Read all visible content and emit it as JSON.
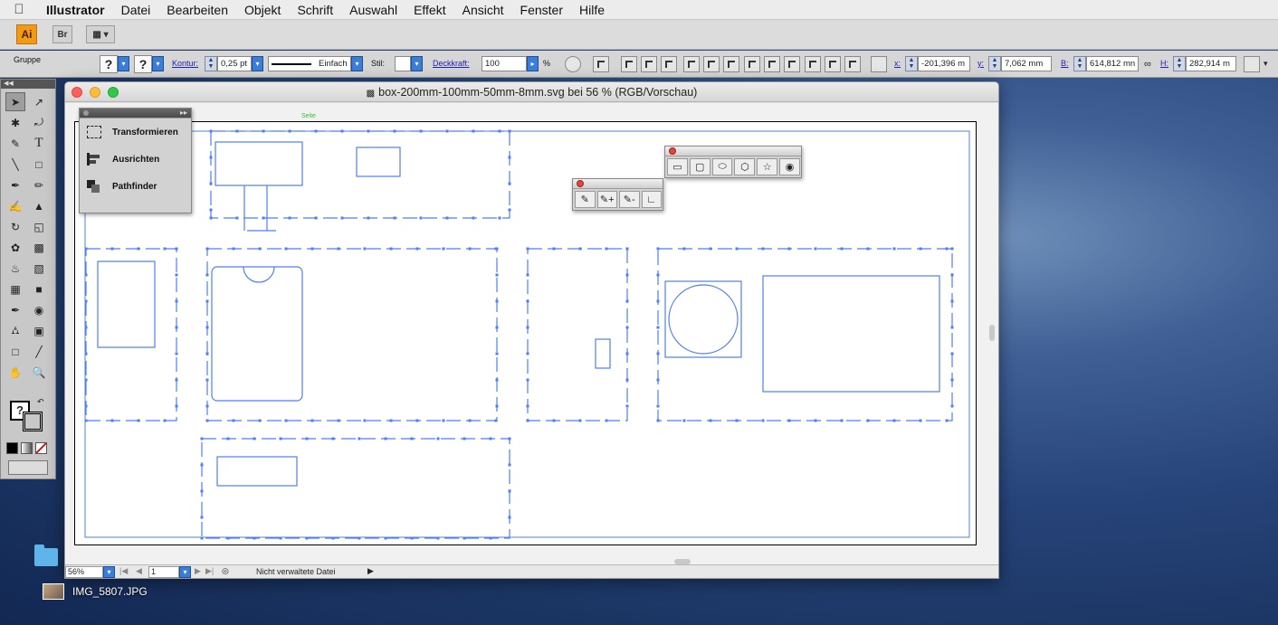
{
  "menubar": {
    "app_name": "Illustrator",
    "items": [
      "Datei",
      "Bearbeiten",
      "Objekt",
      "Schrift",
      "Auswahl",
      "Effekt",
      "Ansicht",
      "Fenster",
      "Hilfe"
    ]
  },
  "appbar": {
    "logo": "Ai",
    "bridge_label": "Br"
  },
  "control": {
    "selection_type": "Gruppe",
    "kontur_label": "Kontur:",
    "kontur_value": "0,25 pt",
    "stroke_profile": "Einfach",
    "stil_label": "Stil:",
    "deckkraft_label": "Deckkraft:",
    "deckkraft_value": "100",
    "percent": "%",
    "x_label": "x:",
    "x_value": "-201,396 m",
    "y_label": "y:",
    "y_value": "7,062 mm",
    "b_label": "B:",
    "b_value": "614,812 mn",
    "h_label": "H:",
    "h_value": "282,914 m"
  },
  "document": {
    "title": "box-200mm-100mm-50mm-8mm.svg bei 56 % (RGB/Vorschau)",
    "artboard_label": "Seite",
    "zoom": "56%",
    "page": "1",
    "status": "Nicht verwaltete Datei"
  },
  "panels": {
    "transform_label": "Transformieren",
    "align_label": "Ausrichten",
    "pathfinder_label": "Pathfinder"
  },
  "desktop": {
    "file_label": "IMG_5807.JPG"
  },
  "colors": {
    "path_blue": "#4f7ff0",
    "accent_orange": "#f39a15"
  }
}
